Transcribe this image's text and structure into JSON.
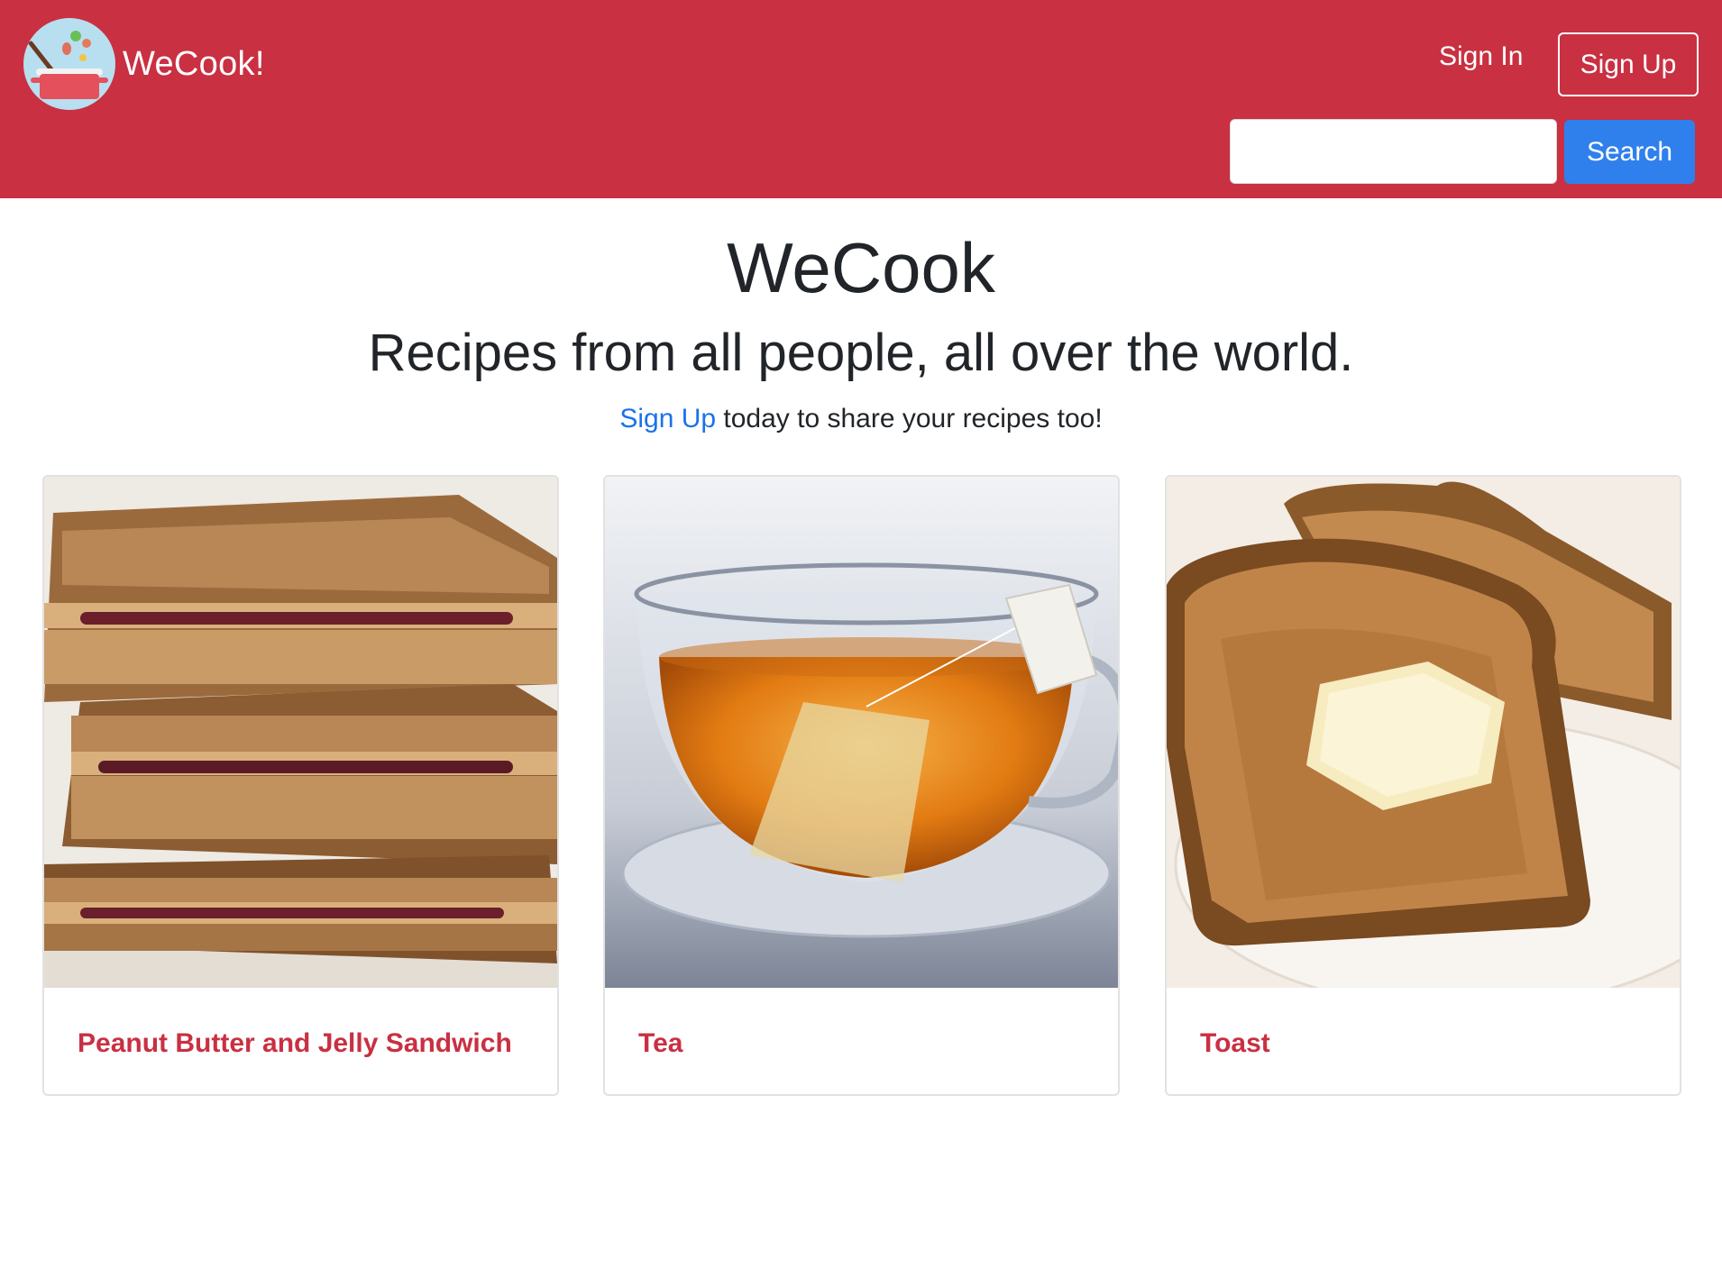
{
  "navbar": {
    "brand": "WeCook!",
    "signin_label": "Sign In",
    "signup_label": "Sign Up",
    "search_value": "",
    "search_button": "Search",
    "colors": {
      "background": "#c93042",
      "search_button": "#2f80ed"
    }
  },
  "hero": {
    "title": "WeCook",
    "subtitle": "Recipes from all people, all over the world.",
    "cta_link": "Sign Up",
    "cta_text": " today to share your recipes too!"
  },
  "recipes": [
    {
      "title": "Peanut Butter and Jelly Sandwich",
      "image": "pbj-sandwich-image"
    },
    {
      "title": "Tea",
      "image": "tea-cup-image"
    },
    {
      "title": "Toast",
      "image": "buttered-toast-image"
    }
  ]
}
